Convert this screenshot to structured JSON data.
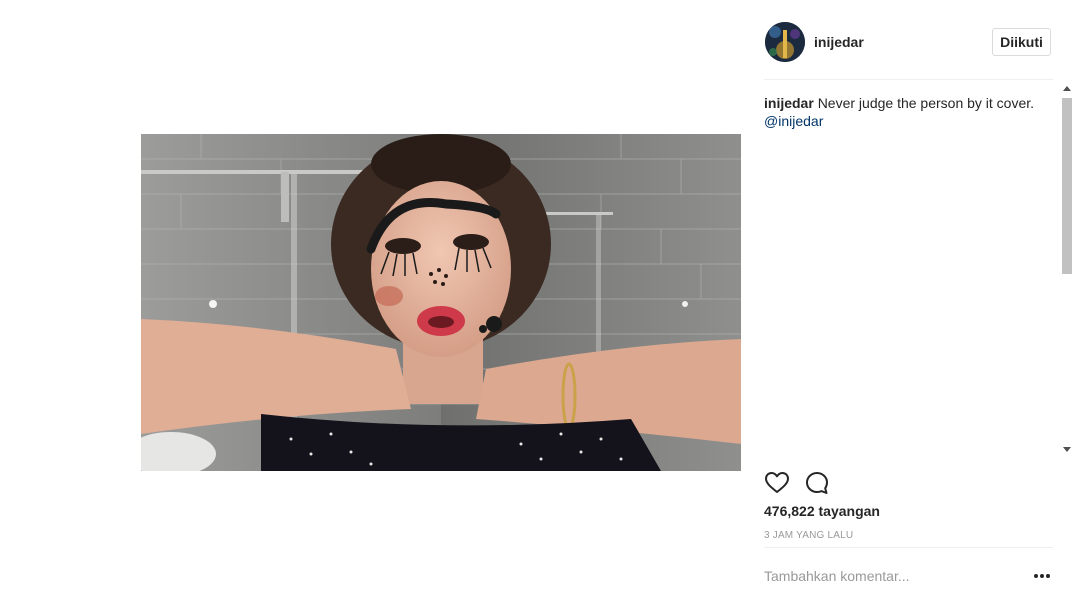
{
  "post": {
    "username": "inijedar",
    "follow_label": "Diikuti",
    "caption": {
      "username": "inijedar",
      "text": "Never judge the person by it cover.",
      "mention": "@inijedar"
    },
    "views": "476,822 tayangan",
    "timestamp": "3 JAM YANG LALU",
    "comment_placeholder": "Tambahkan komentar...",
    "more_label": "•••"
  },
  "icons": {
    "like": "heart-icon",
    "comment": "comment-bubble-icon",
    "more": "more-options-icon",
    "avatar": "profile-avatar"
  },
  "colors": {
    "text": "#262626",
    "link": "#003569",
    "muted": "#999999",
    "divider": "#efefef",
    "button_border": "#dbdbdb"
  }
}
